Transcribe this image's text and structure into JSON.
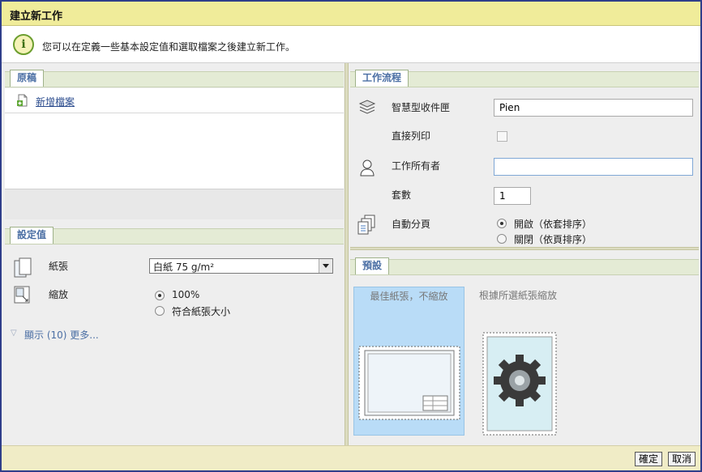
{
  "window": {
    "title": "建立新工作"
  },
  "info": {
    "message": "您可以在定義一些基本設定值和選取檔案之後建立新工作。",
    "icon": "info-icon"
  },
  "originals": {
    "tab": "原稿",
    "add_file": "新增檔案"
  },
  "settings": {
    "tab": "設定值",
    "paper_label": "紙張",
    "paper_value": "白紙 75 g/m²",
    "zoom_label": "縮放",
    "zoom_options": [
      "100%",
      "符合紙張大小"
    ],
    "zoom_selected": 0,
    "show_more": "顯示 (10) 更多..."
  },
  "workflow": {
    "tab": "工作流程",
    "smart_inbox_label": "智慧型收件匣",
    "smart_inbox_value": "Pien",
    "direct_print_label": "直接列印",
    "job_owner_label": "工作所有者",
    "job_owner_value": "",
    "copies_label": "套數",
    "copies_value": "1",
    "collate_label": "自動分頁",
    "collate_options": [
      "開啟（依套排序）",
      "關閉（依頁排序）"
    ],
    "collate_selected": 0
  },
  "presets": {
    "tab": "預設",
    "items": [
      "最佳紙張，不縮放",
      "根據所選紙張縮放"
    ],
    "selected": 0
  },
  "footer": {
    "ok": "確定",
    "cancel": "取消"
  },
  "colors": {
    "title_bar": "#f0ec9a",
    "section_tab": "#4b6fa4",
    "selected_preset": "#b9dcf7",
    "frame": "#2f3e8a"
  }
}
